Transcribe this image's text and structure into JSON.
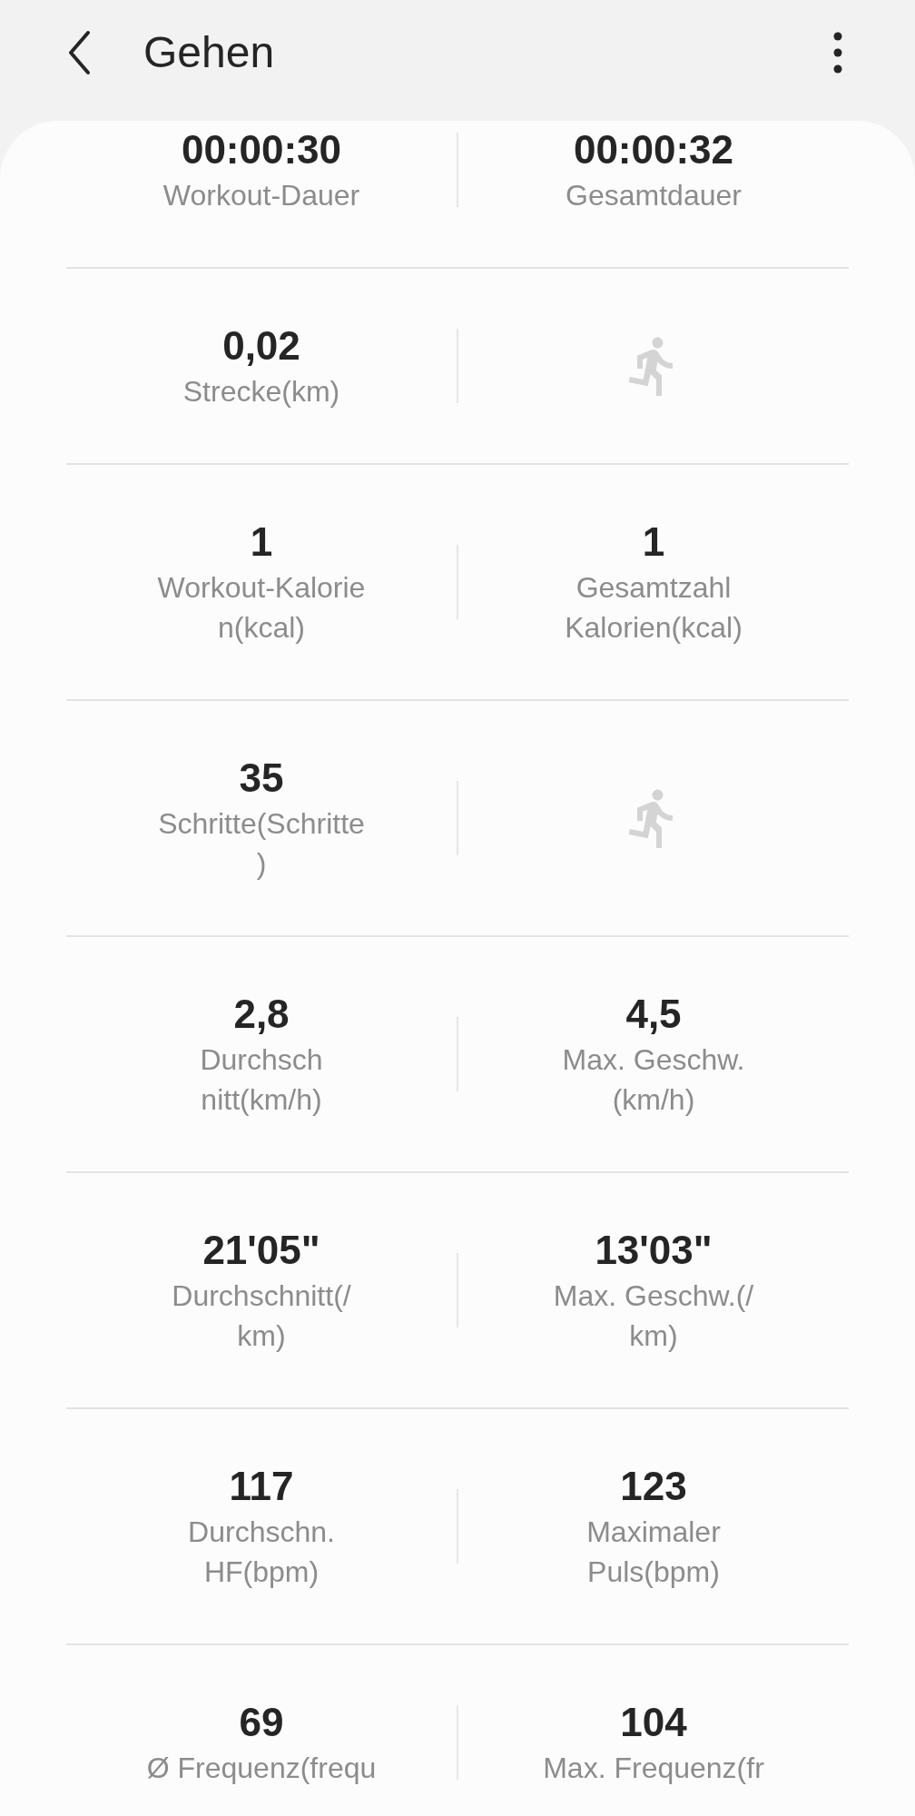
{
  "header": {
    "title": "Gehen"
  },
  "rows": [
    {
      "cells": [
        {
          "kind": "stat",
          "value": "00:00:30",
          "label_lines": [
            "Workout-Dauer"
          ]
        },
        {
          "kind": "stat",
          "value": "00:00:32",
          "label_lines": [
            "Gesamtdauer"
          ]
        }
      ]
    },
    {
      "cells": [
        {
          "kind": "stat",
          "value": "0,02",
          "label_lines": [
            "Strecke(km)"
          ]
        },
        {
          "kind": "icon"
        }
      ]
    },
    {
      "cells": [
        {
          "kind": "stat",
          "value": "1",
          "label_lines": [
            "Workout-Kalorie",
            "n(kcal)"
          ]
        },
        {
          "kind": "stat",
          "value": "1",
          "label_lines": [
            "Gesamtzahl",
            "Kalorien(kcal)"
          ]
        }
      ]
    },
    {
      "cells": [
        {
          "kind": "stat",
          "value": "35",
          "label_lines": [
            "Schritte(Schritte",
            ")"
          ]
        },
        {
          "kind": "icon"
        }
      ]
    },
    {
      "cells": [
        {
          "kind": "stat",
          "value": "2,8",
          "label_lines": [
            "Durchsch",
            "nitt(km/h)"
          ]
        },
        {
          "kind": "stat",
          "value": "4,5",
          "label_lines": [
            "Max. Geschw.",
            "(km/h)"
          ]
        }
      ]
    },
    {
      "cells": [
        {
          "kind": "stat",
          "value": "21'05\"",
          "label_lines": [
            "Durchschnitt(/",
            "km)"
          ]
        },
        {
          "kind": "stat",
          "value": "13'03\"",
          "label_lines": [
            "Max. Geschw.(/",
            "km)"
          ]
        }
      ]
    },
    {
      "cells": [
        {
          "kind": "stat",
          "value": "117",
          "label_lines": [
            "Durchschn.",
            "HF(bpm)"
          ]
        },
        {
          "kind": "stat",
          "value": "123",
          "label_lines": [
            "Maximaler",
            "Puls(bpm)"
          ]
        }
      ]
    },
    {
      "cells": [
        {
          "kind": "stat",
          "value": "69",
          "label_lines": [
            "Ø Frequenz(frequ"
          ]
        },
        {
          "kind": "stat",
          "value": "104",
          "label_lines": [
            "Max. Frequenz(fr"
          ]
        }
      ]
    }
  ]
}
